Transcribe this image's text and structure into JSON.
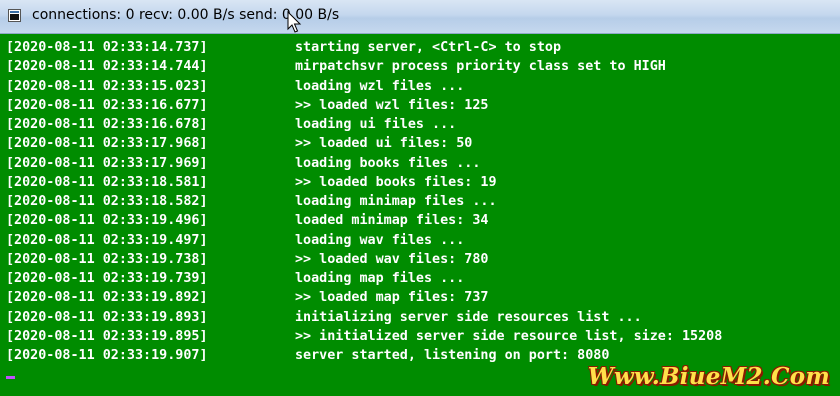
{
  "window": {
    "title": "connections: 0 recv: 0.00 B/s send: 0.00 B/s",
    "icon": "console-window-icon"
  },
  "console": {
    "background": "#008c00",
    "text_color": "#ffffff",
    "lines": [
      {
        "ts": "[2020-08-11 02:33:14.737]",
        "msg": "starting server, <Ctrl-C> to stop"
      },
      {
        "ts": "[2020-08-11 02:33:14.744]",
        "msg": "mirpatchsvr process priority class set to HIGH"
      },
      {
        "ts": "[2020-08-11 02:33:15.023]",
        "msg": "loading wzl files ..."
      },
      {
        "ts": "[2020-08-11 02:33:16.677]",
        "msg": ">> loaded wzl files: 125"
      },
      {
        "ts": "[2020-08-11 02:33:16.678]",
        "msg": "loading ui files ..."
      },
      {
        "ts": "[2020-08-11 02:33:17.968]",
        "msg": ">> loaded ui files: 50"
      },
      {
        "ts": "[2020-08-11 02:33:17.969]",
        "msg": "loading books files ..."
      },
      {
        "ts": "[2020-08-11 02:33:18.581]",
        "msg": ">> loaded books files: 19"
      },
      {
        "ts": "[2020-08-11 02:33:18.582]",
        "msg": "loading minimap files ..."
      },
      {
        "ts": "[2020-08-11 02:33:19.496]",
        "msg": "loaded minimap files: 34"
      },
      {
        "ts": "[2020-08-11 02:33:19.497]",
        "msg": "loading wav files ..."
      },
      {
        "ts": "[2020-08-11 02:33:19.738]",
        "msg": ">> loaded wav files: 780"
      },
      {
        "ts": "[2020-08-11 02:33:19.739]",
        "msg": "loading map files ..."
      },
      {
        "ts": "[2020-08-11 02:33:19.892]",
        "msg": ">> loaded map files: 737"
      },
      {
        "ts": "[2020-08-11 02:33:19.893]",
        "msg": "initializing server side resources list ..."
      },
      {
        "ts": "[2020-08-11 02:33:19.895]",
        "msg": ">> initialized server side resource list, size: 15208"
      },
      {
        "ts": "[2020-08-11 02:33:19.907]",
        "msg": "server started, listening on port: 8080"
      }
    ]
  },
  "watermark": {
    "text": "Www.BiueM2.Com",
    "color": "#ffe14a",
    "outline_color": "#8a1a00"
  }
}
